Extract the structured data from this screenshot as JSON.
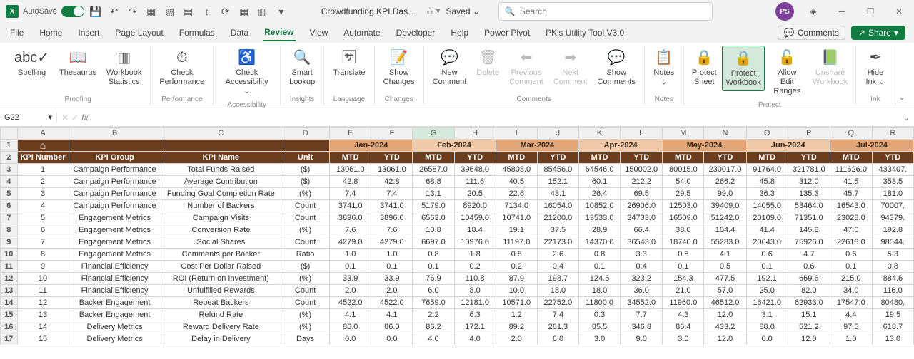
{
  "titlebar": {
    "autosave_label": "AutoSave",
    "autosave_on": "On",
    "doc_name": "Crowdfunding KPI Dashb...",
    "saved": "Saved ⌄",
    "search_placeholder": "Search",
    "user_initials": "PS"
  },
  "tabs": {
    "file": "File",
    "home": "Home",
    "insert": "Insert",
    "page_layout": "Page Layout",
    "formulas": "Formulas",
    "data": "Data",
    "review": "Review",
    "view": "View",
    "automate": "Automate",
    "developer": "Developer",
    "help": "Help",
    "power_pivot": "Power Pivot",
    "pk_tool": "PK's Utility Tool V3.0",
    "comments_btn": "Comments",
    "share_btn": "Share"
  },
  "ribbon": {
    "spelling": "Spelling",
    "thesaurus": "Thesaurus",
    "workbook_stats": "Workbook\nStatistics",
    "check_perf": "Check\nPerformance",
    "check_access": "Check\nAccessibility ⌄",
    "smart_lookup": "Smart\nLookup",
    "translate": "Translate",
    "show_changes": "Show\nChanges",
    "new_comment": "New\nComment",
    "delete": "Delete",
    "previous_comment": "Previous\nComment",
    "next_comment": "Next\nComment",
    "show_comments": "Show\nComments",
    "notes": "Notes\n⌄",
    "protect_sheet": "Protect\nSheet",
    "protect_workbook": "Protect\nWorkbook",
    "allow_edit": "Allow Edit\nRanges",
    "unshare": "Unshare\nWorkbook",
    "hide_ink": "Hide\nInk ⌄",
    "g_proofing": "Proofing",
    "g_performance": "Performance",
    "g_accessibility": "Accessibility",
    "g_insights": "Insights",
    "g_language": "Language",
    "g_changes": "Changes",
    "g_comments": "Comments",
    "g_notes": "Notes",
    "g_protect": "Protect",
    "g_ink": "Ink"
  },
  "formula_bar": {
    "cell_ref": "G22",
    "fx": "fx"
  },
  "columns": [
    "A",
    "B",
    "C",
    "D",
    "E",
    "F",
    "G",
    "H",
    "I",
    "J",
    "K",
    "L",
    "M",
    "N",
    "O",
    "P",
    "Q",
    "R"
  ],
  "months": [
    "Jan-2024",
    "Feb-2024",
    "Mar-2024",
    "Apr-2024",
    "May-2024",
    "Jun-2024",
    "Jul-2024"
  ],
  "headers": {
    "kpi_number": "KPI Number",
    "kpi_group": "KPI Group",
    "kpi_name": "KPI Name",
    "unit": "Unit",
    "mtd": "MTD",
    "ytd": "YTD"
  },
  "rows": [
    {
      "n": "1",
      "g": "Campaign Performance",
      "name": "Total Funds Raised",
      "u": "($)",
      "v": [
        "13061.0",
        "13061.0",
        "26587.0",
        "39648.0",
        "45808.0",
        "85456.0",
        "64546.0",
        "150002.0",
        "80015.0",
        "230017.0",
        "91764.0",
        "321781.0",
        "111626.0",
        "433407."
      ]
    },
    {
      "n": "2",
      "g": "Campaign Performance",
      "name": "Average Contribution",
      "u": "($)",
      "v": [
        "42.8",
        "42.8",
        "68.8",
        "111.6",
        "40.5",
        "152.1",
        "60.1",
        "212.2",
        "54.0",
        "266.2",
        "45.8",
        "312.0",
        "41.5",
        "353.5"
      ]
    },
    {
      "n": "3",
      "g": "Campaign Performance",
      "name": "Funding Goal Completion Rate",
      "u": "(%)",
      "v": [
        "7.4",
        "7.4",
        "13.1",
        "20.5",
        "22.6",
        "43.1",
        "26.4",
        "69.5",
        "29.5",
        "99.0",
        "36.3",
        "135.3",
        "45.7",
        "181.0"
      ]
    },
    {
      "n": "4",
      "g": "Campaign Performance",
      "name": "Number of Backers",
      "u": "Count",
      "v": [
        "3741.0",
        "3741.0",
        "5179.0",
        "8920.0",
        "7134.0",
        "16054.0",
        "10852.0",
        "26906.0",
        "12503.0",
        "39409.0",
        "14055.0",
        "53464.0",
        "16543.0",
        "70007."
      ]
    },
    {
      "n": "5",
      "g": "Engagement Metrics",
      "name": "Campaign Visits",
      "u": "Count",
      "v": [
        "3896.0",
        "3896.0",
        "6563.0",
        "10459.0",
        "10741.0",
        "21200.0",
        "13533.0",
        "34733.0",
        "16509.0",
        "51242.0",
        "20109.0",
        "71351.0",
        "23028.0",
        "94379."
      ]
    },
    {
      "n": "6",
      "g": "Engagement Metrics",
      "name": "Conversion Rate",
      "u": "(%)",
      "v": [
        "7.6",
        "7.6",
        "10.8",
        "18.4",
        "19.1",
        "37.5",
        "28.9",
        "66.4",
        "38.0",
        "104.4",
        "41.4",
        "145.8",
        "47.0",
        "192.8"
      ]
    },
    {
      "n": "7",
      "g": "Engagement Metrics",
      "name": "Social Shares",
      "u": "Count",
      "v": [
        "4279.0",
        "4279.0",
        "6697.0",
        "10976.0",
        "11197.0",
        "22173.0",
        "14370.0",
        "36543.0",
        "18740.0",
        "55283.0",
        "20643.0",
        "75926.0",
        "22618.0",
        "98544."
      ]
    },
    {
      "n": "8",
      "g": "Engagement Metrics",
      "name": "Comments per Backer",
      "u": "Ratio",
      "v": [
        "1.0",
        "1.0",
        "0.8",
        "1.8",
        "0.8",
        "2.6",
        "0.8",
        "3.3",
        "0.8",
        "4.1",
        "0.6",
        "4.7",
        "0.6",
        "5.3"
      ]
    },
    {
      "n": "9",
      "g": "Financial Efficiency",
      "name": "Cost Per Dollar Raised",
      "u": "($)",
      "v": [
        "0.1",
        "0.1",
        "0.1",
        "0.2",
        "0.2",
        "0.4",
        "0.1",
        "0.4",
        "0.1",
        "0.5",
        "0.1",
        "0.6",
        "0.1",
        "0.8"
      ]
    },
    {
      "n": "10",
      "g": "Financial Efficiency",
      "name": "ROI (Return on Investment)",
      "u": "(%)",
      "v": [
        "33.9",
        "33.9",
        "76.9",
        "110.8",
        "87.9",
        "198.7",
        "124.5",
        "323.2",
        "154.3",
        "477.5",
        "192.1",
        "669.6",
        "215.0",
        "884.6"
      ]
    },
    {
      "n": "11",
      "g": "Financial Efficiency",
      "name": "Unfulfilled Rewards",
      "u": "Count",
      "v": [
        "2.0",
        "2.0",
        "6.0",
        "8.0",
        "10.0",
        "18.0",
        "18.0",
        "36.0",
        "21.0",
        "57.0",
        "25.0",
        "82.0",
        "34.0",
        "116.0"
      ]
    },
    {
      "n": "12",
      "g": "Backer Engagement",
      "name": "Repeat Backers",
      "u": "Count",
      "v": [
        "4522.0",
        "4522.0",
        "7659.0",
        "12181.0",
        "10571.0",
        "22752.0",
        "11800.0",
        "34552.0",
        "11960.0",
        "46512.0",
        "16421.0",
        "62933.0",
        "17547.0",
        "80480."
      ]
    },
    {
      "n": "13",
      "g": "Backer Engagement",
      "name": "Refund Rate",
      "u": "(%)",
      "v": [
        "4.1",
        "4.1",
        "2.2",
        "6.3",
        "1.2",
        "7.4",
        "0.3",
        "7.7",
        "4.3",
        "12.0",
        "3.1",
        "15.1",
        "4.4",
        "19.5"
      ]
    },
    {
      "n": "14",
      "g": "Delivery Metrics",
      "name": "Reward Delivery Rate",
      "u": "(%)",
      "v": [
        "86.0",
        "86.0",
        "86.2",
        "172.1",
        "89.2",
        "261.3",
        "85.5",
        "346.8",
        "86.4",
        "433.2",
        "88.0",
        "521.2",
        "97.5",
        "618.7"
      ]
    },
    {
      "n": "15",
      "g": "Delivery Metrics",
      "name": "Delay in Delivery",
      "u": "Days",
      "v": [
        "0.0",
        "0.0",
        "4.0",
        "4.0",
        "2.0",
        "6.0",
        "3.0",
        "9.0",
        "3.0",
        "12.0",
        "0.0",
        "12.0",
        "1.0",
        "13.0"
      ]
    }
  ],
  "active_cell": "G22",
  "selected_col": "G",
  "home_icon": "⌂"
}
